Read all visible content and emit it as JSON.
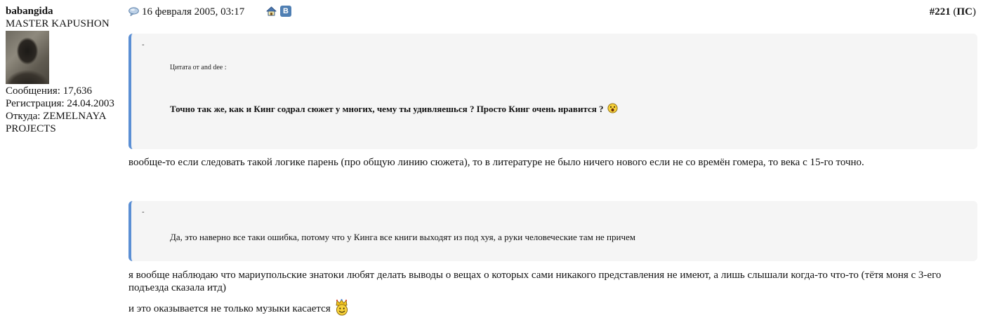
{
  "user": {
    "name": "babangida",
    "rank": "MASTER KAPUSHON",
    "messages": "Сообщения: 17,636",
    "registered": "Регистрация: 24.04.2003",
    "location": "Откуда: ZEMELNAYA PROJECTS"
  },
  "post": {
    "date": "16 февраля 2005, 03:17",
    "number": "#221",
    "number_tag_open": " (",
    "number_tag": "ПС",
    "number_tag_close": ")",
    "icons": {
      "post": "speech-bubble-icon",
      "home": "home-icon",
      "vk": "vk-icon"
    },
    "vk_letter": "B"
  },
  "quotes": [
    {
      "dash": "-",
      "author": "Цитата от and dee :",
      "text": "Точно так же, как и Кинг содрал сюжет у многих, чему ты удивляешься ? Просто Кинг очень нравится ?",
      "smiley": "yawn-smiley-icon"
    },
    {
      "dash": "-",
      "text": "Да, это наверно все таки ошибка, потому что у Кинга все книги выходят из под хуя, а руки человеческие там не причем"
    }
  ],
  "body": {
    "paragraph_1": "вообще-то если следовать такой логике парень (про общую линию сюжета), то в литературе не было ничего нового если не со времён гомера, то века с 15-го точно.",
    "paragraph_2": "я вообще наблюдаю что мариупольские знатоки любят делать выводы о вещах о которых сами никакого представления не имеют, а лишь слышали когда-то что-то (тётя моня с 3-его подъезда сказала итд)",
    "paragraph_3": "и это оказывается не только музыки касается",
    "smiley": "king-crown-smiley-icon"
  },
  "colors": {
    "quote_border": "#5b8fd4",
    "quote_background": "#f5f5f5",
    "vk_blue": "#4f7fb3"
  }
}
